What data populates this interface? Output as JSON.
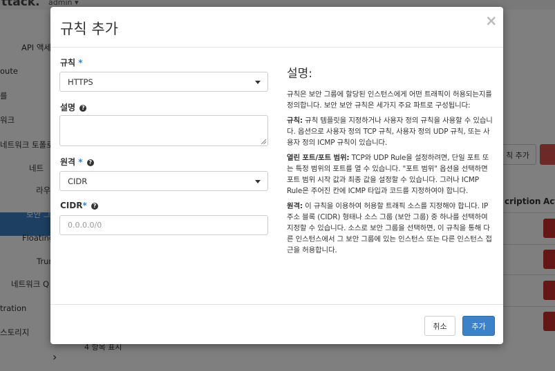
{
  "app": {
    "logo_text": "ttack.",
    "user_menu": "admin ▾"
  },
  "sidebar": {
    "items": [
      {
        "label": "API 액세"
      },
      {
        "label": "oute"
      },
      {
        "label": "를"
      },
      {
        "label": "워크"
      },
      {
        "label": "네트워크 토폴로"
      },
      {
        "label": "네트"
      },
      {
        "label": "라우"
      },
      {
        "label": "보안 그"
      },
      {
        "label": "Floating"
      },
      {
        "label": "Trun"
      },
      {
        "label": "네트워크 Q"
      },
      {
        "label": "tration"
      },
      {
        "label": "스토리지"
      }
    ]
  },
  "background": {
    "add_rule_button": "칙 추가",
    "col_description": "cription",
    "col_actions": "Act",
    "footer_count": "4 항목 표시"
  },
  "modal": {
    "title": "규칙 추가",
    "close": "×",
    "rule": {
      "label": "규칙",
      "required": "*",
      "value": "HTTPS"
    },
    "description": {
      "label": "설명"
    },
    "remote": {
      "label": "원격",
      "required": "*",
      "value": "CIDR"
    },
    "cidr": {
      "label": "CIDR",
      "required": "*",
      "placeholder": "0.0.0.0/0"
    },
    "help": {
      "title": "설명:",
      "intro": "규칙은 보안 그룹에 할당된 인스턴스에게 어떤 트래픽이 허용되는지를 정의합니다. 보안 보안 규칙은 세가지 주요 파트로 구성됩니다:",
      "rule_term": "규칙:",
      "rule_text": " 규칙 템플릿을 지정하거나 사용자 정의 규칙을 사용할 수 있습니다. 옵션으로 사용자 정의 TCP 규칙, 사용자 정의 UDP 규칙, 또는 사용자 정의 ICMP 규칙이 있습니다.",
      "port_term": "열린 포트/포트 범위:",
      "port_text": " TCP와 UDP Rule을 설정하려면, 단일 포트 또는 특정 범위의 포트를 열 수 있습니다. \"포트 범위\" 옵션을 선택하면 포트 범위 시작 값과 최종 값을 설정할 수 있습니다. 그러나 ICMP Rule은 주어진 칸에 ICMP 타입과 코드를 지정하여야 합니다.",
      "remote_term": "원격:",
      "remote_text": " 이 규칙을 이용하여 허용할 트래픽 소스를 지정해야 합니다. IP 주소 블록 (CIDR) 형태나 소스 그룹 (보안 그룹) 중 하나를 선택하여 지정할 수 있습니다. 소스로 보안 그룹을 선택하면, 이 규칙을 통해 다른 인스턴스에서 그 보안 그룹에 있는 인스턴스 또는 다른 인스턴스 접근을 허용합니다."
    },
    "footer": {
      "cancel": "취소",
      "submit": "추가"
    }
  }
}
